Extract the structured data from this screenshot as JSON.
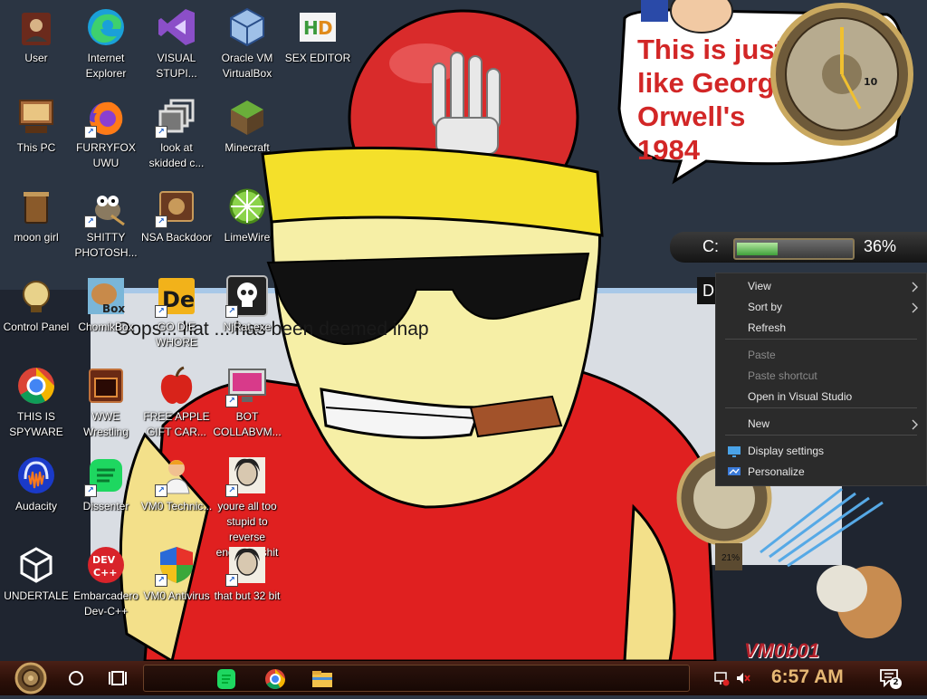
{
  "desktop_icons": [
    {
      "label": "User",
      "icon": "user-folder-icon"
    },
    {
      "label": "Internet Explorer",
      "icon": "edge-icon"
    },
    {
      "label": "VISUAL STUPI...",
      "icon": "visual-studio-icon"
    },
    {
      "label": "Oracle VM VirtualBox",
      "icon": "virtualbox-icon"
    },
    {
      "label": "SEX EDITOR",
      "icon": "hex-editor-icon"
    },
    {
      "label": "This PC",
      "icon": "computer-icon"
    },
    {
      "label": "FURRYFOX UWU",
      "icon": "firefox-icon"
    },
    {
      "label": "look at skidded c...",
      "icon": "stacked-windows-icon"
    },
    {
      "label": "Minecraft",
      "icon": "minecraft-icon"
    },
    {
      "label": "moon girl",
      "icon": "trash-bin-icon"
    },
    {
      "label": "SHITTY PHOTOSH...",
      "icon": "gimp-icon"
    },
    {
      "label": "NSA Backdoor",
      "icon": "network-icon"
    },
    {
      "label": "LimeWire",
      "icon": "limewire-icon"
    },
    {
      "label": "Control Panel",
      "icon": "control-panel-icon"
    },
    {
      "label": "ChomikBox",
      "icon": "chomikbox-icon"
    },
    {
      "label": "GO DIE WHORE",
      "icon": "de-icon"
    },
    {
      "label": "NjRat.exe",
      "icon": "skull-icon"
    },
    {
      "label": "THIS IS SPYWARE",
      "icon": "chrome-icon"
    },
    {
      "label": "WWE Wrestling",
      "icon": "oven-icon"
    },
    {
      "label": "FREE APPLE GIFT CAR...",
      "icon": "apple-icon"
    },
    {
      "label": "BOT COLLABVM...",
      "icon": "monitor-icon"
    },
    {
      "label": "Audacity",
      "icon": "audacity-icon"
    },
    {
      "label": "Dissenter",
      "icon": "spotify-icon"
    },
    {
      "label": "VM0 Technic...",
      "icon": "technician-icon"
    },
    {
      "label": "youre all too stupid to reverse engineer shit",
      "icon": "portrait-icon"
    },
    {
      "label": "UNDERTALE",
      "icon": "unity-icon"
    },
    {
      "label": "Embarcadero Dev-C++",
      "icon": "devcpp-icon"
    },
    {
      "label": "VM0 Antivirus",
      "icon": "shield-icon"
    },
    {
      "label": "that but 32 bit",
      "icon": "portrait-icon"
    }
  ],
  "wallpaper": {
    "banner_text": "Oops... hat ... has been deemed inap",
    "speech_text": "This is just like George Orwell's 1984",
    "vm_tag": "VM0b01"
  },
  "drive_gauge": {
    "drive": "C:",
    "percent": "36%",
    "fill": 0.36,
    "drive2": "D"
  },
  "clock_widget": {
    "day": "10"
  },
  "context_menu": {
    "items": [
      {
        "label": "View",
        "submenu": true,
        "disabled": false,
        "icon": ""
      },
      {
        "label": "Sort by",
        "submenu": true,
        "disabled": false,
        "icon": ""
      },
      {
        "label": "Refresh",
        "submenu": false,
        "disabled": false,
        "icon": ""
      },
      {
        "label": "Paste",
        "submenu": false,
        "disabled": true,
        "icon": ""
      },
      {
        "label": "Paste shortcut",
        "submenu": false,
        "disabled": true,
        "icon": ""
      },
      {
        "label": "Open in Visual Studio",
        "submenu": false,
        "disabled": false,
        "icon": ""
      },
      {
        "label": "New",
        "submenu": true,
        "disabled": false,
        "icon": ""
      },
      {
        "label": "Display settings",
        "submenu": false,
        "disabled": false,
        "icon": "display-icon"
      },
      {
        "label": "Personalize",
        "submenu": false,
        "disabled": false,
        "icon": "personalize-icon"
      }
    ]
  },
  "taskbar": {
    "pinned": [
      "spotify-icon",
      "chrome-icon",
      "file-explorer-icon"
    ],
    "time": "6:57 AM",
    "notification_count": "2",
    "gauge_percent": "21%"
  },
  "colors": {
    "accent": "#e6b874",
    "taskbar": "#3a170d",
    "menu": "#2b2b2b"
  }
}
